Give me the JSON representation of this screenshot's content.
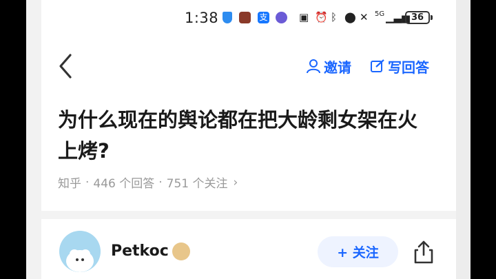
{
  "status_bar": {
    "time": "1:38",
    "network": "5G",
    "battery": "36",
    "alipay_icon_label": "支"
  },
  "header": {
    "invite_label": "邀请",
    "write_answer_label": "写回答"
  },
  "question": {
    "title": "为什么现在的舆论都在把大龄剩女架在火上烤?",
    "source": "知乎",
    "answers": "446 个回答",
    "followers": "751 个关注",
    "separator": "·"
  },
  "answer": {
    "author_name": "Petkoc",
    "follow_label": "+ 关注"
  },
  "colors": {
    "accent": "#1a66ff",
    "title": "#1a1a1a",
    "meta": "#999999"
  }
}
